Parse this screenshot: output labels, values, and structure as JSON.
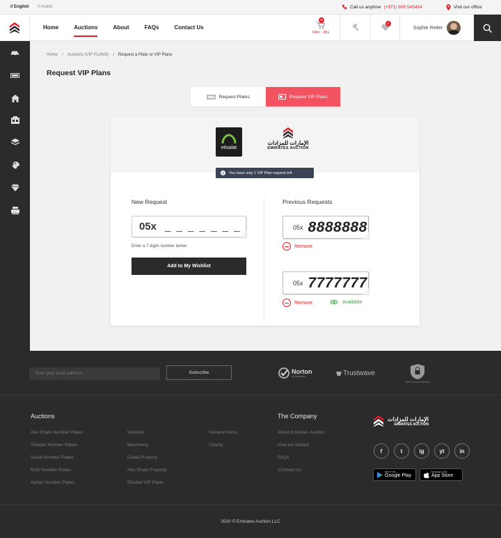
{
  "topbar": {
    "lang_en": "// English",
    "lang_ar": "// Arabic",
    "call_text": "Call us anytime",
    "phone": "(+971) 600 545454",
    "visit_text": "Visit our office"
  },
  "header": {
    "nav": [
      "Home",
      "Auctions",
      "About",
      "FAQs",
      "Contact Us"
    ],
    "active_nav": "Auctions",
    "cart_badge": "15",
    "timer": "04m : 45s",
    "wishlist_badge": "4",
    "user_name": "Sophie Reiter"
  },
  "sidebar": {
    "icons": [
      "car-icon",
      "plate-icon",
      "home-icon",
      "property-icon",
      "layers-icon",
      "palette-icon",
      "diamond-icon",
      "machinery-icon"
    ]
  },
  "breadcrumb": {
    "home": "Home",
    "auctions": "Auctions (VIP PLANS)",
    "current": "Request a Plate or VIP Plans"
  },
  "page_title": "Request VIP Plans",
  "tabs": {
    "plates": "Request Plates",
    "vip": "Request VIP Plans"
  },
  "card": {
    "etisalat_label": "etisalat",
    "ea_brand": "EMIRATES AUCTION",
    "ea_arabic": "الإمارات للمزادات",
    "notice": "You have only 1 VIP Plan request left",
    "new_request_title": "New Request",
    "plate_prefix": "05x",
    "plate_placeholder": "_ _ _ _ _ _ _",
    "hint": "Enter a 7 digits number below",
    "wishlist_button": "Add to My Wishlist",
    "previous_title": "Previous Requests",
    "previous": [
      {
        "prefix": "05x",
        "number": "8888888",
        "remove": "Remove",
        "status": ""
      },
      {
        "prefix": "05x",
        "number": "7777777",
        "remove": "Remove",
        "status": "Available"
      }
    ]
  },
  "subscribe": {
    "placeholder": "Enter your email address",
    "button": "Subscribe",
    "norton_brand": "Norton",
    "norton_tagline": "by Symantec",
    "trustwave": "Trustwave",
    "secure": "100% Secure Payment"
  },
  "footer": {
    "auctions_title": "Auctions",
    "col1": [
      "Abu Dhabi Number Plates",
      "Sharjah Number Plates",
      "Dubai Number Plates",
      "RAK Number Plates",
      "Ajman Number Plates"
    ],
    "col2": [
      "Vehicles",
      "Machinery",
      "Dubai Property",
      "Abu Dhabi Property",
      "Etisalat VIP Plans"
    ],
    "col3": [
      "General Items",
      "Charity"
    ],
    "company_title": "The Company",
    "col4": [
      "About Emirates Auction",
      "How we started",
      "FAQs",
      "COntact Us"
    ],
    "brand": "EMIRATES AUCTION",
    "brand_arabic": "الإمارات للمزادات",
    "social": [
      "f",
      "t",
      "ig",
      "yt",
      "in"
    ],
    "google_play_small": "GET IT ON",
    "google_play": "Google Play",
    "app_store_small": "Download on the",
    "app_store": "App Store"
  },
  "copyright": "2020 © Emirates Auction LLC"
}
